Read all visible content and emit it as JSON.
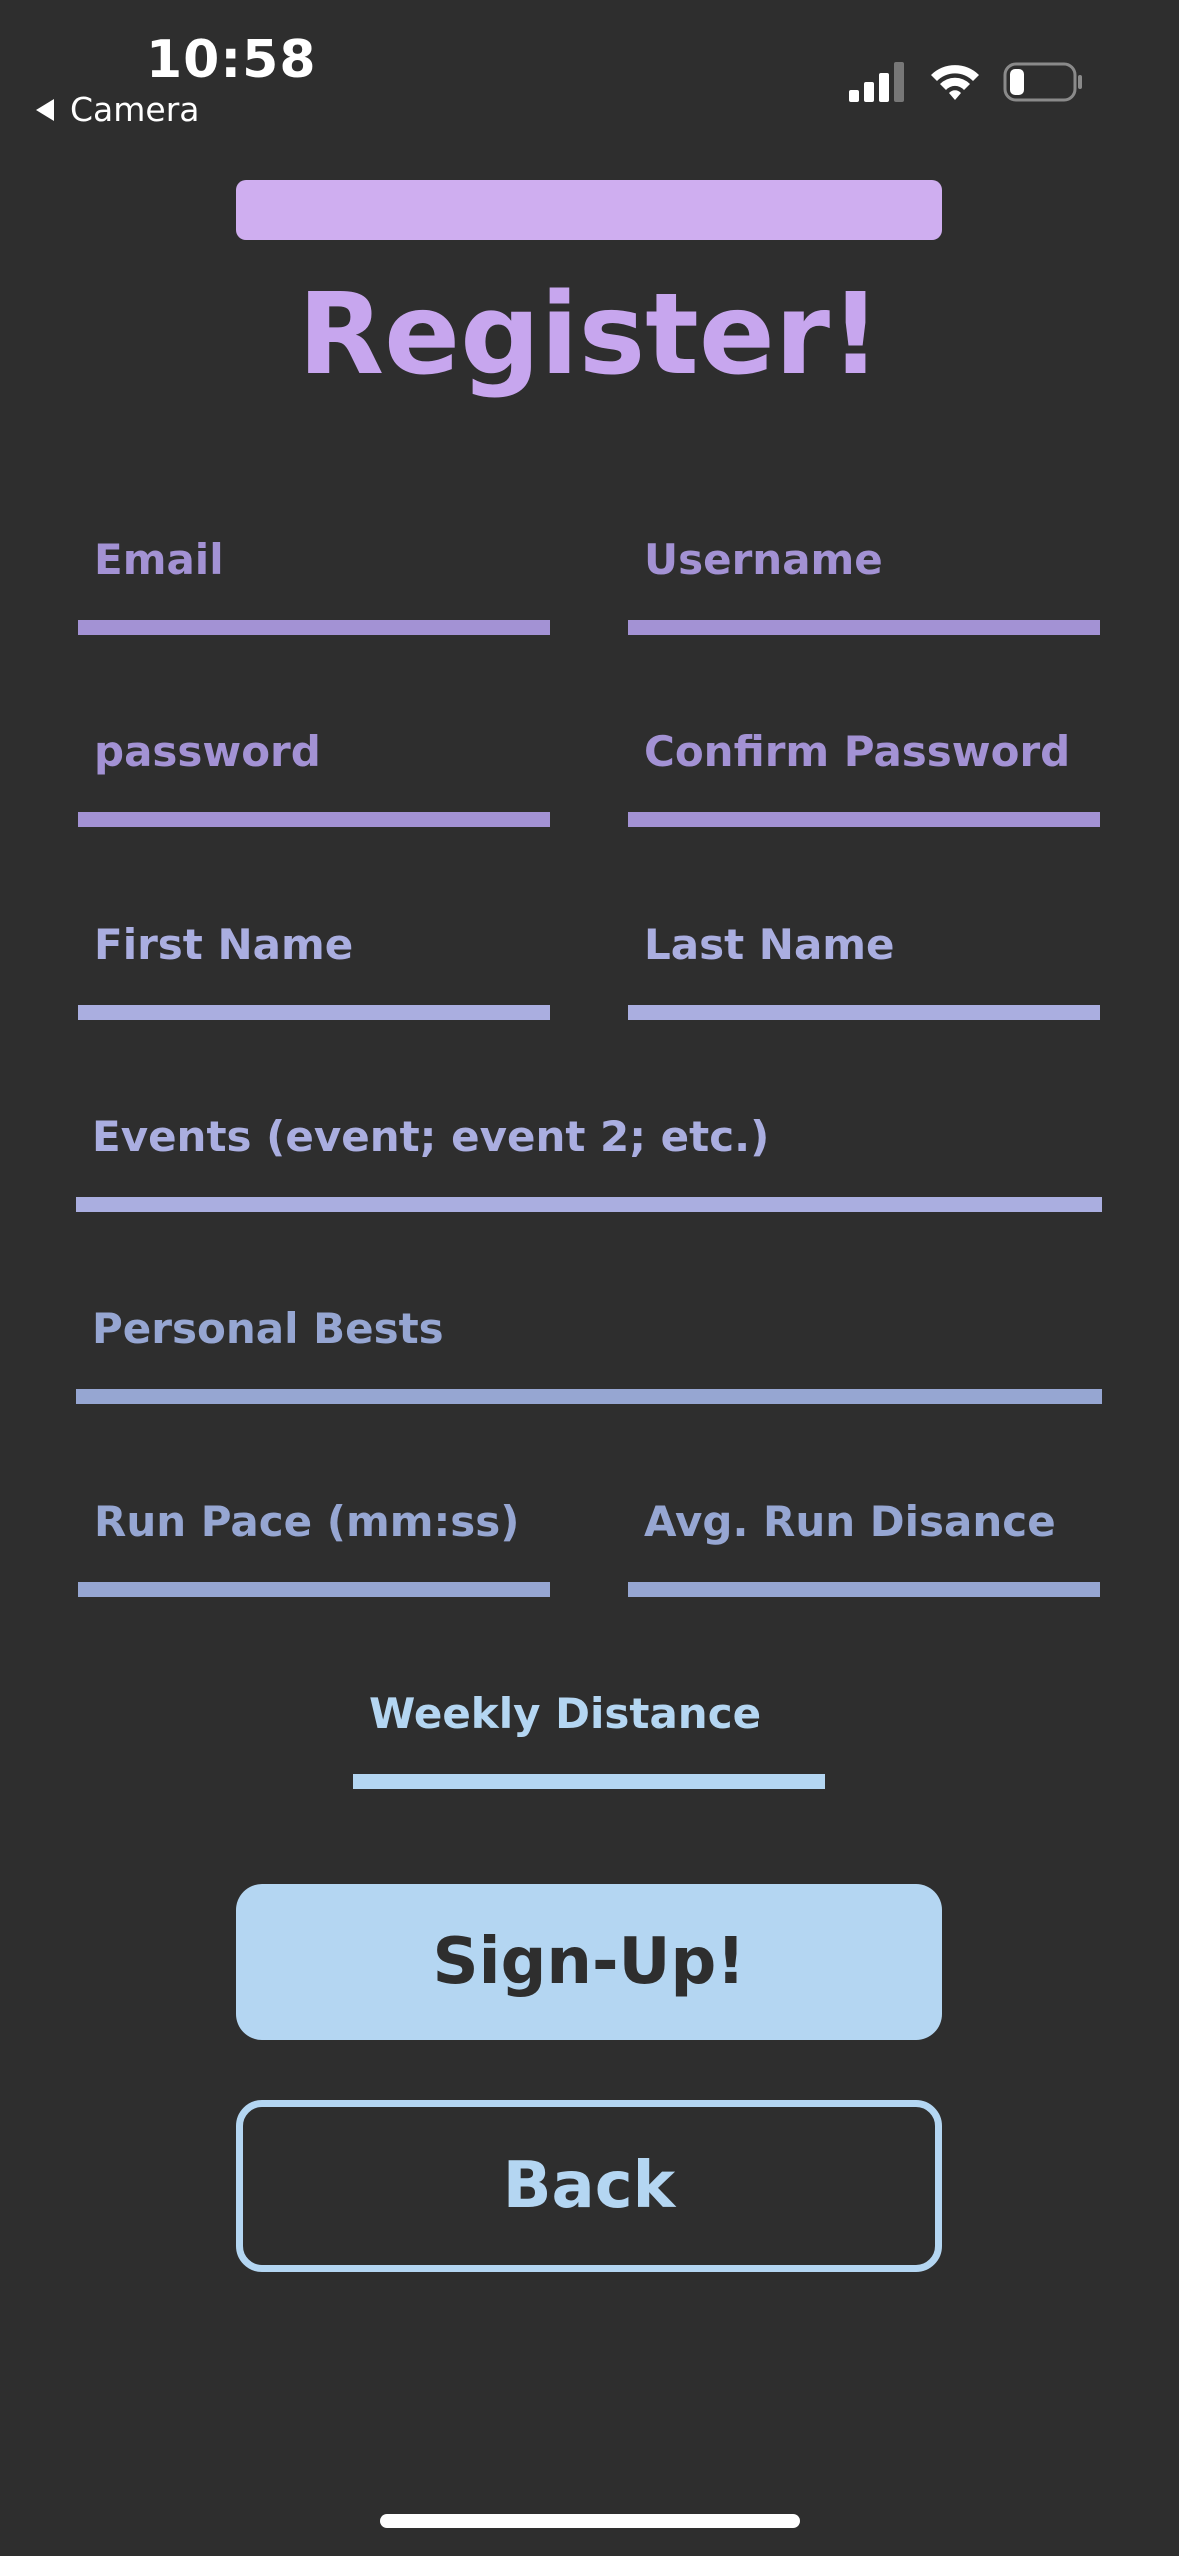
{
  "status_bar": {
    "time": "10:58",
    "back_app_label": "Camera",
    "icons": [
      "cellular-signal-icon",
      "wifi-icon",
      "battery-icon"
    ]
  },
  "header": {
    "title": "Register!"
  },
  "form": {
    "email": {
      "label": "Email"
    },
    "username": {
      "label": "Username"
    },
    "password": {
      "label": "password"
    },
    "confirm_password": {
      "label": "Confirm Password"
    },
    "first_name": {
      "label": "First Name"
    },
    "last_name": {
      "label": "Last Name"
    },
    "events": {
      "label": "Events (event; event 2; etc.)"
    },
    "personal_bests": {
      "label": "Personal Bests"
    },
    "run_pace": {
      "label": "Run Pace (mm:ss)"
    },
    "avg_run_distance": {
      "label": "Avg. Run Disance"
    },
    "weekly_distance": {
      "label": "Weekly Distance"
    }
  },
  "buttons": {
    "signup": "Sign-Up!",
    "back": "Back"
  },
  "colors": {
    "background": "#2e2e2e",
    "accent_purple": "#c7a6ee",
    "label_purple": "#a392d4",
    "label_lavender": "#aaaee0",
    "label_steel": "#96a6d2",
    "accent_blue": "#b4d6f2"
  }
}
